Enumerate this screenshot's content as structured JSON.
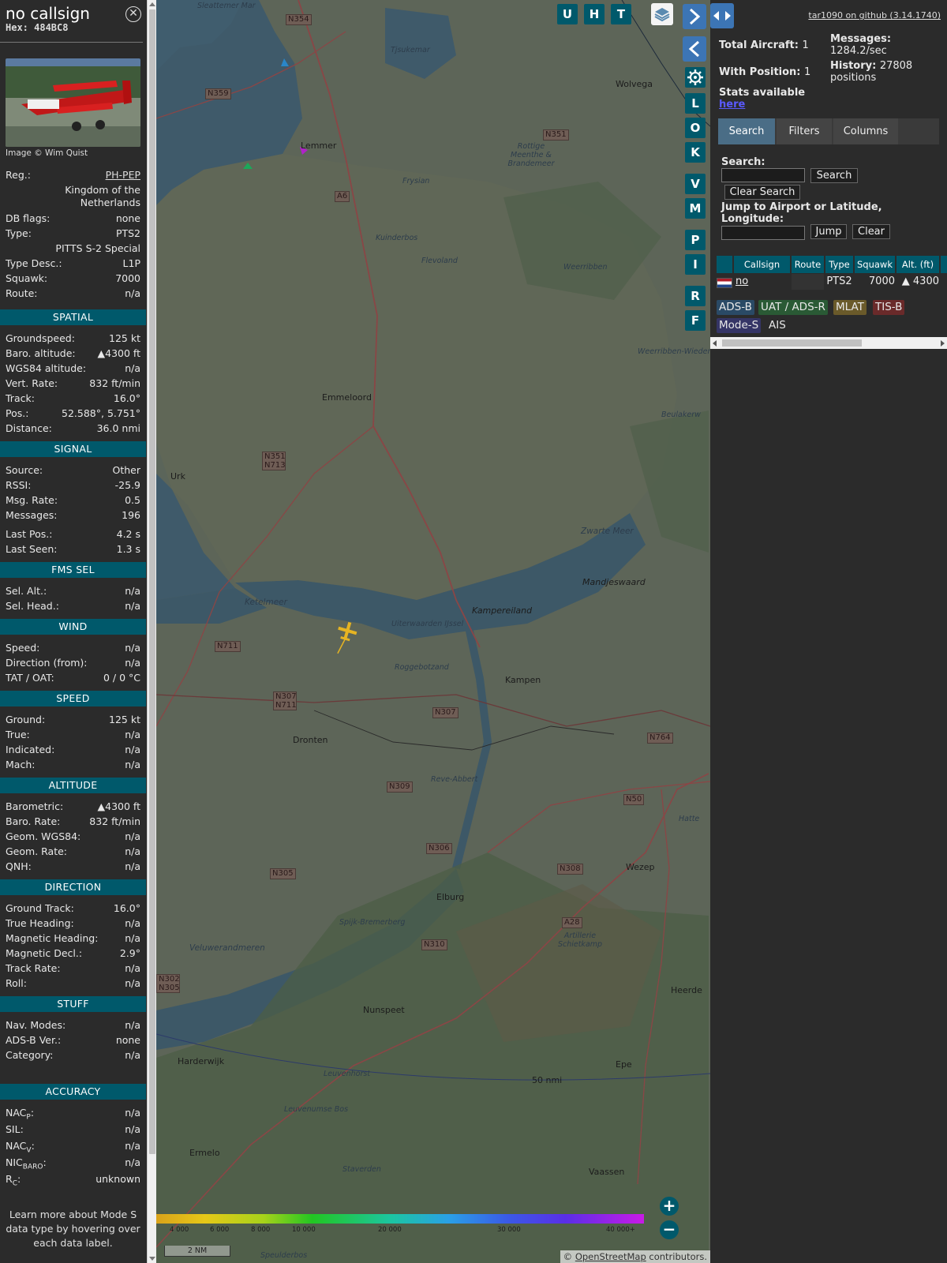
{
  "aircraft": {
    "callsign": "no callsign",
    "hex": "Hex: 484BC8",
    "photo_credit": "Image © Wim Quist",
    "reg_label": "Reg.:",
    "reg": "PH-PEP",
    "country": "Kingdom of the Netherlands",
    "dbflags_label": "DB flags:",
    "dbflags": "none",
    "type_label": "Type:",
    "type": "PTS2",
    "model": "PITTS S-2 Special",
    "typedesc_label": "Type Desc.:",
    "typedesc": "L1P",
    "squawk_label": "Squawk:",
    "squawk": "7000",
    "route_label": "Route:",
    "route": "n/a"
  },
  "sections": {
    "spatial": "SPATIAL",
    "signal": "SIGNAL",
    "fms": "FMS SEL",
    "wind": "WIND",
    "speed": "SPEED",
    "altitude": "ALTITUDE",
    "direction": "DIRECTION",
    "stuff": "STUFF",
    "accuracy": "ACCURACY"
  },
  "spatial": [
    [
      "Groundspeed:",
      "125 kt"
    ],
    [
      "Baro. altitude:",
      "▲4300 ft"
    ],
    [
      "WGS84 altitude:",
      "n/a"
    ],
    [
      "Vert. Rate:",
      "832 ft/min"
    ],
    [
      "Track:",
      "16.0°"
    ],
    [
      "Pos.:",
      "52.588°, 5.751°"
    ],
    [
      "Distance:",
      "36.0 nmi"
    ]
  ],
  "signal": [
    [
      "Source:",
      "Other"
    ],
    [
      "RSSI:",
      "-25.9"
    ],
    [
      "Msg. Rate:",
      "0.5"
    ],
    [
      "Messages:",
      "196"
    ],
    [
      "Last Pos.:",
      "4.2 s"
    ],
    [
      "Last Seen:",
      "1.3 s"
    ]
  ],
  "fms": [
    [
      "Sel. Alt.:",
      "n/a"
    ],
    [
      "Sel. Head.:",
      "n/a"
    ]
  ],
  "wind": [
    [
      "Speed:",
      "n/a"
    ],
    [
      "Direction (from):",
      "n/a"
    ],
    [
      "TAT / OAT:",
      "0 / 0 °C"
    ]
  ],
  "speed": [
    [
      "Ground:",
      "125 kt"
    ],
    [
      "True:",
      "n/a"
    ],
    [
      "Indicated:",
      "n/a"
    ],
    [
      "Mach:",
      "n/a"
    ]
  ],
  "altitude": [
    [
      "Barometric:",
      "▲4300 ft"
    ],
    [
      "Baro. Rate:",
      "832 ft/min"
    ],
    [
      "Geom. WGS84:",
      "n/a"
    ],
    [
      "Geom. Rate:",
      "n/a"
    ],
    [
      "QNH:",
      "n/a"
    ]
  ],
  "direction": [
    [
      "Ground Track:",
      "16.0°"
    ],
    [
      "True Heading:",
      "n/a"
    ],
    [
      "Magnetic Heading:",
      "n/a"
    ],
    [
      "Magnetic Decl.:",
      "2.9°"
    ],
    [
      "Track Rate:",
      "n/a"
    ],
    [
      "Roll:",
      "n/a"
    ]
  ],
  "stuff": [
    [
      "Nav. Modes:",
      "n/a"
    ],
    [
      "ADS-B Ver.:",
      "none"
    ],
    [
      "Category:",
      "n/a"
    ]
  ],
  "accuracy": [
    [
      "NAC",
      "P",
      ":",
      "n/a"
    ],
    [
      "SIL:",
      "",
      "",
      "n/a"
    ],
    [
      "NAC",
      "V",
      ":",
      "n/a"
    ],
    [
      "NIC",
      "BARO",
      ":",
      "n/a"
    ],
    [
      "R",
      "C",
      ":",
      "unknown"
    ]
  ],
  "footer_note": "Learn more about Mode S data type by hovering over each data label.",
  "map": {
    "buttons_top": [
      "U",
      "H",
      "T"
    ],
    "buttons_side": [
      "L",
      "O",
      "K",
      "V",
      "M",
      "P",
      "I",
      "R",
      "F"
    ],
    "places": [
      "Lemmer",
      "Wolvega",
      "Emmeloord",
      "Urk",
      "Kampen",
      "Dronten",
      "Elburg",
      "Wezep",
      "Nunspeet",
      "Harderwijk",
      "Epe",
      "Heerde",
      "Ermelo",
      "Vaassen",
      "Kampereiland",
      "Mandjeswaard"
    ],
    "water": [
      "Ketelmeer",
      "Uiterwaarden IJssel",
      "Veluwerandmeren",
      "Zwarte Meer",
      "Weerribben",
      "Weerribben-Wieden",
      "Kuinderbos",
      "Flevoland",
      "Roggebotzand",
      "Reve-Abbert",
      "Spijk-Bremerberg",
      "Artillerie Schietkamp",
      "Rottige Meenthe & Brandemeer",
      "Leuvenhorst",
      "Leuvenumse Bos",
      "Staverden",
      "Tjsukemar",
      "Speulderbos",
      "Beulakerw",
      "Hatte",
      "Frysian",
      "Sleattemer Mar"
    ],
    "roads": [
      "N359",
      "N351",
      "A6",
      "N351 N713",
      "N711",
      "N307 N711",
      "N307",
      "N764",
      "N309",
      "N50",
      "N306",
      "N305",
      "N308",
      "A28",
      "N310",
      "N302 N305",
      "N354"
    ],
    "altitude_ticks": [
      "4 000",
      "6 000",
      "8 000",
      "10 000",
      "20 000",
      "30 000",
      "40 000+"
    ],
    "scale": "2 NM",
    "range_ring": "50 nmi",
    "attribution_prefix": "© ",
    "attribution_link": "OpenStreetMap",
    "attribution_suffix": " contributors."
  },
  "panel": {
    "github": "tar1090 on github (3.14.1740)",
    "total_label": "Total Aircraft:",
    "total": "1",
    "withpos_label": "With Position:",
    "withpos": "1",
    "stats_label": "Stats available",
    "stats_link": "here",
    "messages_label": "Messages:",
    "messages": "1284.2/sec",
    "history_label": "History:",
    "history": "27808 positions",
    "tabs": [
      "Search",
      "Filters",
      "Columns"
    ],
    "search_label": "Search:",
    "search_btn": "Search",
    "clear_search_btn": "Clear Search",
    "jump_label": "Jump to Airport or Latitude, Longitude:",
    "jump_btn": "Jump",
    "clear_btn": "Clear",
    "table_headers": [
      "Callsign",
      "Route",
      "Type",
      "Squawk",
      "Alt. (ft)"
    ],
    "table_row": {
      "callsign": "no callsign",
      "route": "",
      "type": "PTS2",
      "squawk": "7000",
      "alt": "▲ 4300"
    },
    "badges": [
      "ADS-B",
      "UAT / ADS-R",
      "MLAT",
      "TIS-B",
      "Mode-S",
      "AIS"
    ]
  },
  "colors": {
    "accent": "#00596b",
    "plane": "#e6b422",
    "badge_adsb": "#2a4a66",
    "badge_uat": "#2a5a35",
    "badge_mlat": "#6a5a2a",
    "badge_tisb": "#6a2a2a",
    "badge_modes": "#353566"
  }
}
